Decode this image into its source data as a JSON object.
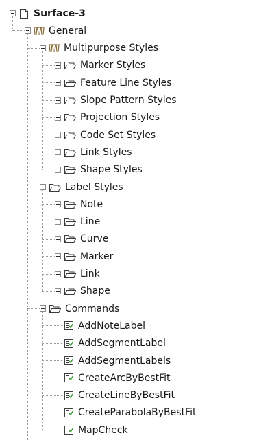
{
  "tree": {
    "root": {
      "label": "Surface-3",
      "icon": "page-icon",
      "expanded": true
    },
    "general": {
      "label": "General",
      "icon": "styles-icon",
      "expanded": true
    },
    "multipurpose": {
      "label": "Multipurpose Styles",
      "icon": "styles-icon",
      "expanded": true,
      "children": [
        {
          "label": "Marker Styles",
          "icon": "folder-icon",
          "expanded": false
        },
        {
          "label": "Feature Line Styles",
          "icon": "folder-icon",
          "expanded": false
        },
        {
          "label": "Slope Pattern Styles",
          "icon": "folder-icon",
          "expanded": false
        },
        {
          "label": "Projection Styles",
          "icon": "folder-icon",
          "expanded": false
        },
        {
          "label": "Code Set Styles",
          "icon": "folder-icon",
          "expanded": false
        },
        {
          "label": "Link Styles",
          "icon": "folder-icon",
          "expanded": false
        },
        {
          "label": "Shape Styles",
          "icon": "folder-icon",
          "expanded": false
        }
      ]
    },
    "label_styles": {
      "label": "Label Styles",
      "icon": "folder-icon",
      "expanded": true,
      "children": [
        {
          "label": "Note",
          "icon": "folder-icon",
          "expanded": false
        },
        {
          "label": "Line",
          "icon": "folder-icon",
          "expanded": false
        },
        {
          "label": "Curve",
          "icon": "folder-icon",
          "expanded": false
        },
        {
          "label": "Marker",
          "icon": "folder-icon",
          "expanded": false
        },
        {
          "label": "Link",
          "icon": "folder-icon",
          "expanded": false
        },
        {
          "label": "Shape",
          "icon": "folder-icon",
          "expanded": false
        }
      ]
    },
    "commands": {
      "label": "Commands",
      "icon": "folder-icon",
      "expanded": true,
      "children": [
        {
          "label": "AddNoteLabel",
          "icon": "command-icon"
        },
        {
          "label": "AddSegmentLabel",
          "icon": "command-icon"
        },
        {
          "label": "AddSegmentLabels",
          "icon": "command-icon"
        },
        {
          "label": "CreateArcByBestFit",
          "icon": "command-icon"
        },
        {
          "label": "CreateLineByBestFit",
          "icon": "command-icon"
        },
        {
          "label": "CreateParabolaByBestFit",
          "icon": "command-icon"
        },
        {
          "label": "MapCheck",
          "icon": "command-icon"
        }
      ]
    }
  },
  "colors": {
    "folder_stroke": "#3a3a3a",
    "styles_icon": "#8a6f3c",
    "command_green": "#3a9a3a",
    "connector": "#9a9a9a"
  }
}
